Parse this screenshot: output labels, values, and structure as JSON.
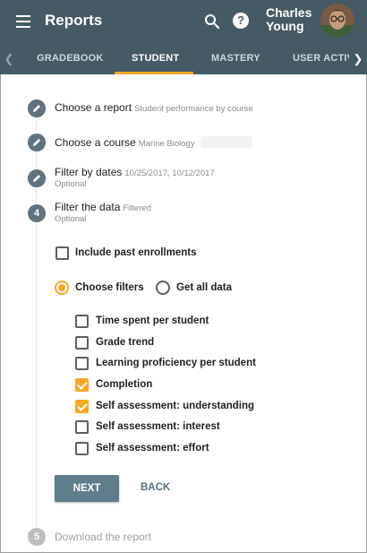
{
  "app": {
    "title": "Reports",
    "user_name": "Charles Young"
  },
  "icons": {
    "menu": "menu-icon",
    "search": "search-icon",
    "help": "help-icon",
    "help_glyph": "?",
    "edit": "pencil-icon"
  },
  "tabs": [
    {
      "label": "GRADEBOOK",
      "active": false
    },
    {
      "label": "STUDENT",
      "active": true
    },
    {
      "label": "MASTERY",
      "active": false
    },
    {
      "label": "USER ACTIV",
      "active": false
    }
  ],
  "steps": [
    {
      "title": "Choose a report",
      "summary": "Student performance by course",
      "state": "done"
    },
    {
      "title": "Choose a course",
      "summary": "Marine Biology",
      "state": "done"
    },
    {
      "title": "Filter by dates",
      "summary": "10/25/2017, 10/12/2017",
      "optional": "Optional",
      "state": "done"
    },
    {
      "number": "4",
      "title": "Filter the data",
      "summary": "Filtered",
      "optional": "Optional",
      "state": "active"
    },
    {
      "number": "5",
      "title": "Download the report",
      "state": "disabled"
    }
  ],
  "filter": {
    "include_past_enrollments": {
      "label": "Include past enrollments",
      "checked": false
    },
    "mode_choose": {
      "label": "Choose filters",
      "selected": true
    },
    "mode_all": {
      "label": "Get all data",
      "selected": false
    },
    "options": [
      {
        "label": "Time spent per student",
        "checked": false
      },
      {
        "label": "Grade trend",
        "checked": false
      },
      {
        "label": "Learning proficiency per student",
        "checked": false
      },
      {
        "label": "Completion",
        "checked": true
      },
      {
        "label": "Self assessment: understanding",
        "checked": true
      },
      {
        "label": "Self assessment: interest",
        "checked": false
      },
      {
        "label": "Self assessment: effort",
        "checked": false
      }
    ]
  },
  "actions": {
    "next": "NEXT",
    "back": "BACK"
  },
  "colors": {
    "appbar": "#455a64",
    "accent": "#f9a825",
    "step_circle": "#5f7380",
    "button": "#607d8b"
  }
}
